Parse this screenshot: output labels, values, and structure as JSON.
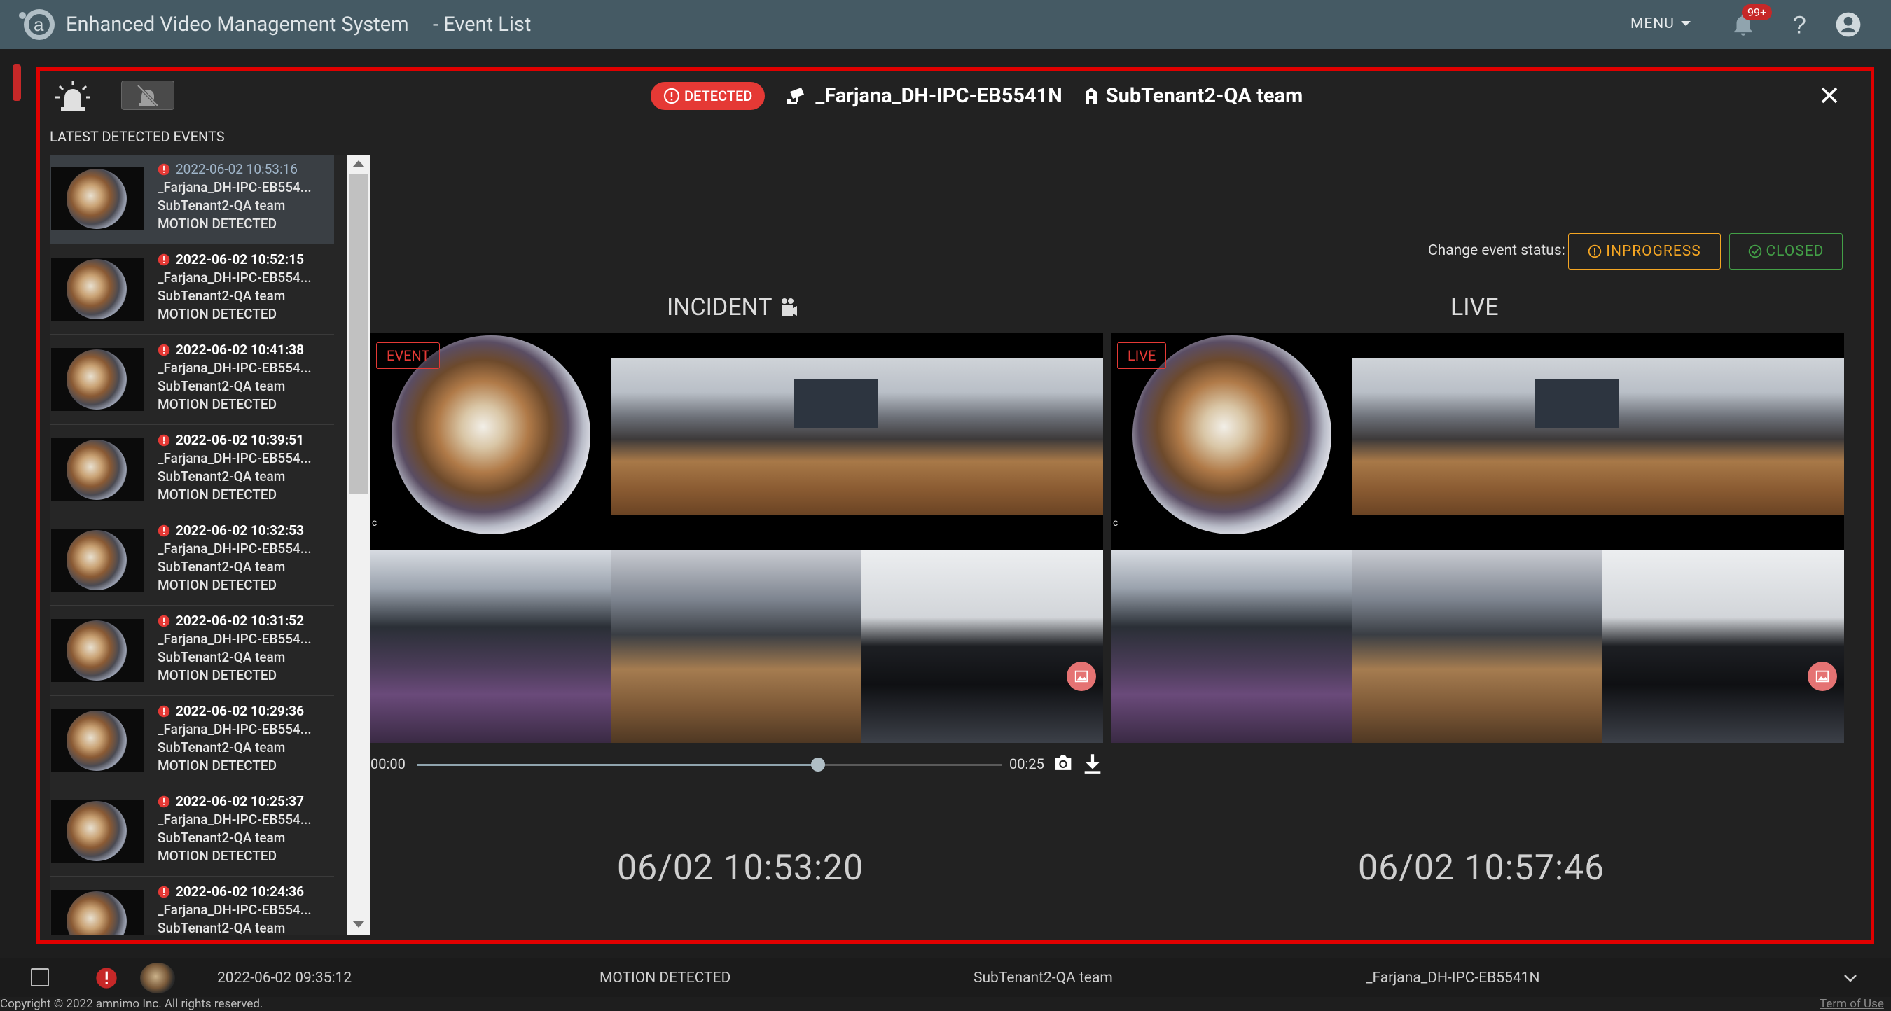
{
  "app": {
    "title": "Enhanced Video Management System",
    "page": "- Event List",
    "menu_label": "MENU",
    "notif_count": "99+"
  },
  "modal": {
    "latest_title": "LATEST DETECTED EVENTS",
    "status_pill": "DETECTED",
    "camera_name": "_Farjana_DH-IPC-EB5541N",
    "tenant": "SubTenant2-QA team",
    "change_status_label": "Change event status:",
    "inprogress_label": "INPROGRESS",
    "closed_label": "CLOSED",
    "incident_title": "INCIDENT",
    "live_title": "LIVE",
    "event_tag": "EVENT",
    "live_tag": "LIVE",
    "player": {
      "start": "00:00",
      "end": "00:25",
      "progress": 0.685
    },
    "incident_timestamp": "06/02 10:53:20",
    "live_timestamp": "06/02 10:57:46"
  },
  "events": [
    {
      "time": "2022-06-02 10:53:16",
      "camera": "_Farjana_DH-IPC-EB554...",
      "tenant": "SubTenant2-QA team",
      "type": "MOTION DETECTED"
    },
    {
      "time": "2022-06-02 10:52:15",
      "camera": "_Farjana_DH-IPC-EB554...",
      "tenant": "SubTenant2-QA team",
      "type": "MOTION DETECTED"
    },
    {
      "time": "2022-06-02 10:41:38",
      "camera": "_Farjana_DH-IPC-EB554...",
      "tenant": "SubTenant2-QA team",
      "type": "MOTION DETECTED"
    },
    {
      "time": "2022-06-02 10:39:51",
      "camera": "_Farjana_DH-IPC-EB554...",
      "tenant": "SubTenant2-QA team",
      "type": "MOTION DETECTED"
    },
    {
      "time": "2022-06-02 10:32:53",
      "camera": "_Farjana_DH-IPC-EB554...",
      "tenant": "SubTenant2-QA team",
      "type": "MOTION DETECTED"
    },
    {
      "time": "2022-06-02 10:31:52",
      "camera": "_Farjana_DH-IPC-EB554...",
      "tenant": "SubTenant2-QA team",
      "type": "MOTION DETECTED"
    },
    {
      "time": "2022-06-02 10:29:36",
      "camera": "_Farjana_DH-IPC-EB554...",
      "tenant": "SubTenant2-QA team",
      "type": "MOTION DETECTED"
    },
    {
      "time": "2022-06-02 10:25:37",
      "camera": "_Farjana_DH-IPC-EB554...",
      "tenant": "SubTenant2-QA team",
      "type": "MOTION DETECTED"
    },
    {
      "time": "2022-06-02 10:24:36",
      "camera": "_Farjana_DH-IPC-EB554...",
      "tenant": "SubTenant2-QA team",
      "type": ""
    }
  ],
  "background_row": {
    "time": "2022-06-02 09:35:12",
    "type": "MOTION DETECTED",
    "tenant": "SubTenant2-QA team",
    "camera": "_Farjana_DH-IPC-EB5541N"
  },
  "footer": {
    "copyright": "Copyright © 2022 amnimo Inc. All rights reserved.",
    "terms": "Term of Use"
  },
  "colors": {
    "topbar": "#455a64",
    "modal_border": "#e00000",
    "detected": "#e53935",
    "inprogress": "#f5a623",
    "closed": "#43a047"
  }
}
